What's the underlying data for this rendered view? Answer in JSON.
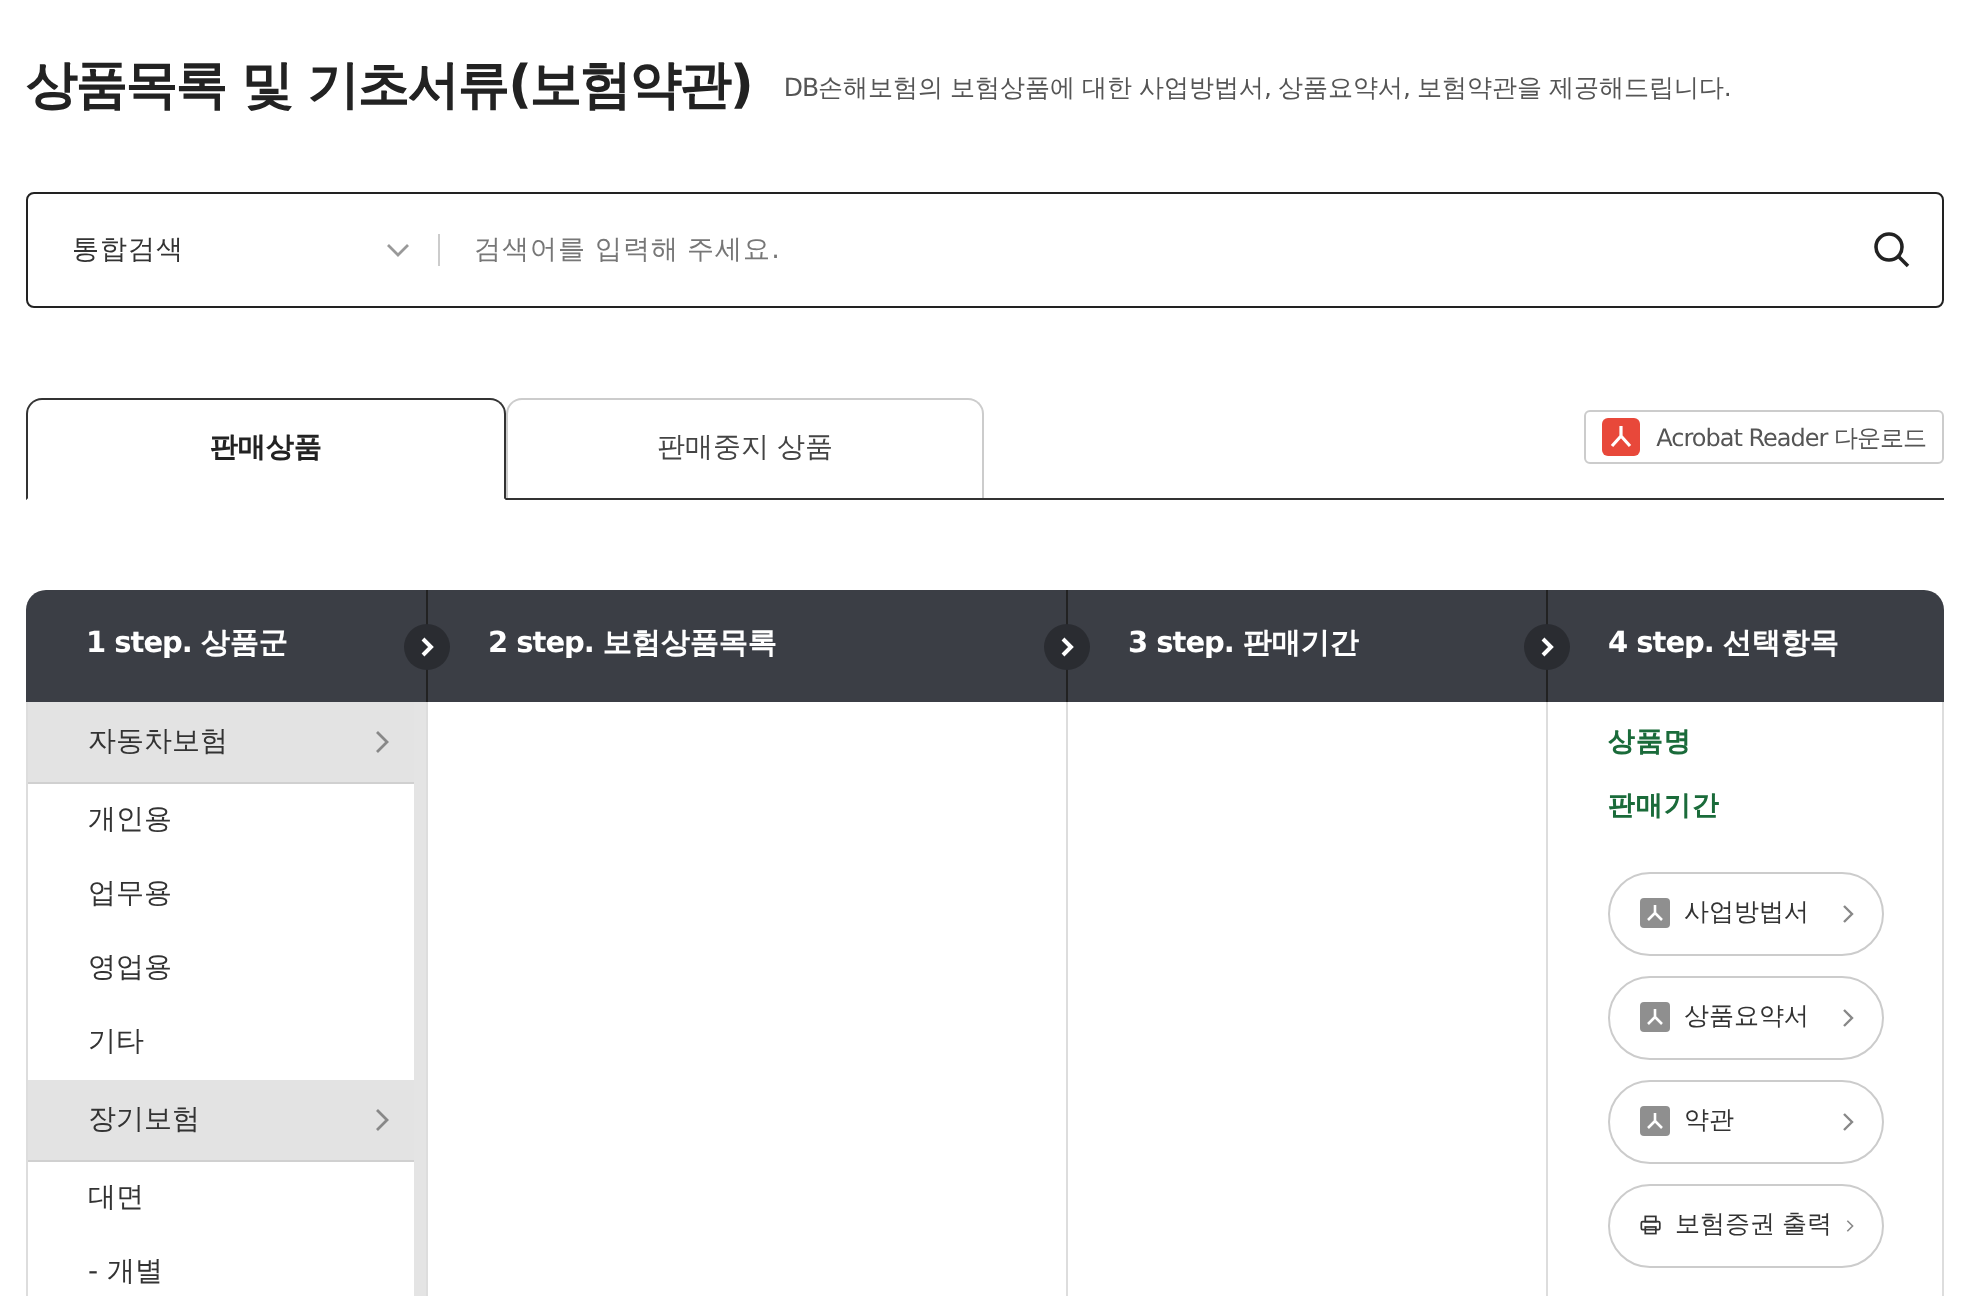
{
  "title": "상품목록 및 기초서류(보험약관)",
  "subtitle": "DB손해보험의 보험상품에 대한 사업방법서, 상품요약서, 보험약관을 제공해드립니다.",
  "search": {
    "category": "통합검색",
    "placeholder": "검색어를 입력해 주세요."
  },
  "tabs": [
    {
      "label": "판매상품",
      "selected": true
    },
    {
      "label": "판매중지 상품",
      "selected": false
    }
  ],
  "acrobat_button": "Acrobat Reader 다운로드",
  "steps": [
    "1 step. 상품군",
    "2 step. 보험상품목록",
    "3 step. 판매기간",
    "4 step. 선택항목"
  ],
  "product_groups": [
    {
      "label": "자동차보험",
      "kind": "group"
    },
    {
      "label": "개인용",
      "kind": "item"
    },
    {
      "label": "업무용",
      "kind": "item"
    },
    {
      "label": "영업용",
      "kind": "item"
    },
    {
      "label": "기타",
      "kind": "item"
    },
    {
      "label": "장기보험",
      "kind": "group"
    },
    {
      "label": "대면",
      "kind": "item"
    },
    {
      "label": "- 개별",
      "kind": "item"
    }
  ],
  "selection_labels": [
    "상품명",
    "판매기간"
  ],
  "documents": [
    {
      "label": "사업방법서",
      "kind": "pdf"
    },
    {
      "label": "상품요약서",
      "kind": "pdf"
    },
    {
      "label": "약관",
      "kind": "pdf"
    },
    {
      "label": "보험증권 출력",
      "kind": "print"
    }
  ]
}
